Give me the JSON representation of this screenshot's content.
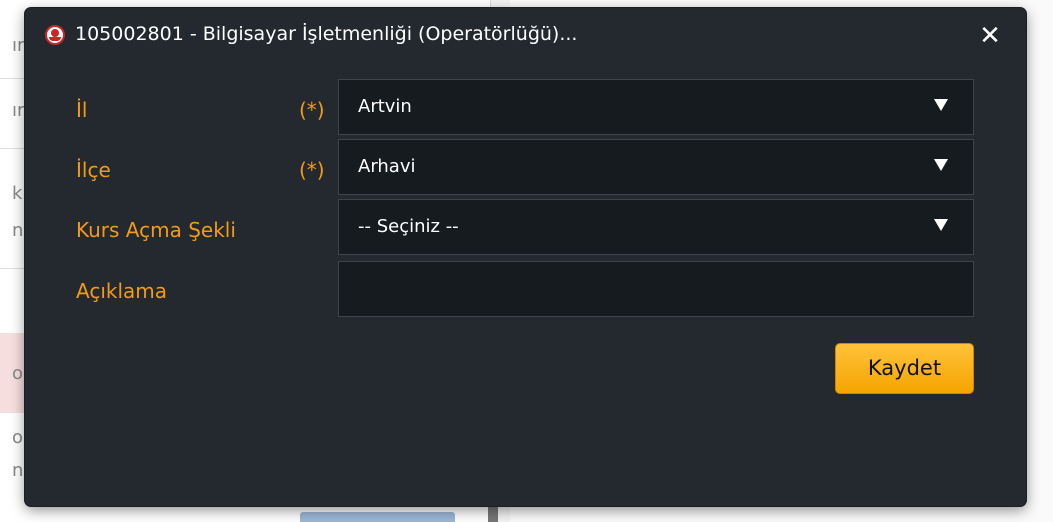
{
  "background": {
    "fragments": [
      "ır",
      "ır",
      "k",
      "n",
      "o",
      "o",
      "n"
    ]
  },
  "dialog": {
    "title": "105002801 - Bilgisayar İşletmenliği (Operatörlüğü)...",
    "close_symbol": "✕",
    "logo_icon": "meb-logo-icon"
  },
  "form": {
    "il": {
      "label": "İl",
      "required_mark": "(*)",
      "value": "Artvin"
    },
    "ilce": {
      "label": "İlçe",
      "required_mark": "(*)",
      "value": "Arhavi"
    },
    "kurs_acma_sekli": {
      "label": "Kurs Açma Şekli",
      "value": "-- Seçiniz --"
    },
    "aciklama": {
      "label": "Açıklama",
      "value": ""
    },
    "save_label": "Kaydet"
  },
  "colors": {
    "dialog_bg": "#23292f",
    "label_orange": "#f39c12",
    "input_bg": "#161b20",
    "button_yellow": "#f5a500"
  }
}
